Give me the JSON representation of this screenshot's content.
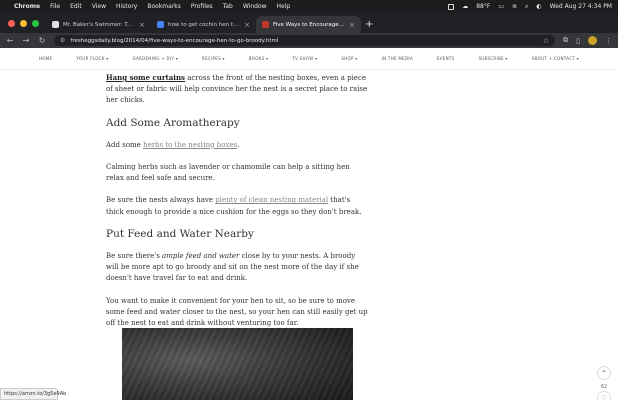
{
  "menubar": {
    "app": "Chrome",
    "items": [
      "File",
      "Edit",
      "View",
      "History",
      "Bookmarks",
      "Profiles",
      "Tab",
      "Window",
      "Help"
    ],
    "temperature": "88°F",
    "datetime": "Wed Aug 27  4:34 PM"
  },
  "tabs": [
    {
      "title": "Mr. Baker's Swimmer: Tutoring"
    },
    {
      "title": "how to get cochin hen to go"
    },
    {
      "title": "Five Ways to Encourage a Hen"
    }
  ],
  "toolbar": {
    "url": "fresheggsdaily.blog/2014/04/five-ways-to-encourage-hen-to-go-broody.html"
  },
  "sitenav": {
    "items": [
      "HOME",
      "YOUR FLOCK ▾",
      "GARDENING + DIY ▾",
      "RECIPES ▾",
      "BOOKS ▾",
      "TV SHOW ▾",
      "SHOP ▾",
      "IN THE MEDIA",
      "EVENTS",
      "SUBSCRIBE ▾",
      "ABOUT + CONTACT ▾"
    ]
  },
  "article": {
    "p1_link": "Hang some curtains",
    "p1_text": " across the front of the nesting boxes, even a piece of sheet or fabric will help convince her the nest is a secret place to raise her chicks.",
    "h_aroma": "Add Some Aromatherapy",
    "p2_pre": "Add some ",
    "p2_link": "herbs to the nesting boxes",
    "p2_post": ".",
    "p3": "Calming herbs such as lavender or chamomile can help a sitting hen relax and feel safe and secure.",
    "p4_pre": "Be sure the nests always have ",
    "p4_link": "plenty of clean nesting material",
    "p4_post": " that's thick enough to provide a nice cushion for the eggs so they don't break.",
    "h_feed": "Put Feed and Water Nearby",
    "p5_pre": "Be sure there's ",
    "p5_em": "ample feed and water",
    "p5_post": " close by to your nests. A broody will be more apt to go broody and sit on the nest more of the day if she doesn't have travel far to eat and drink.",
    "p6": "You want to make it convenient for your hen to sit, so be sure to move some feed and water closer to the nest, so your hen can still easily get up off the nest to eat and drink without venturing too far."
  },
  "widgets": {
    "scroll_top": "⌃",
    "likes_count": "62",
    "heart": "♡"
  },
  "statusbar": {
    "url": "https://amzn.to/3g5e9Ab"
  },
  "colors": {
    "link": "#888888",
    "page_bg": "#ffffff",
    "chrome_dark": "#202124"
  }
}
